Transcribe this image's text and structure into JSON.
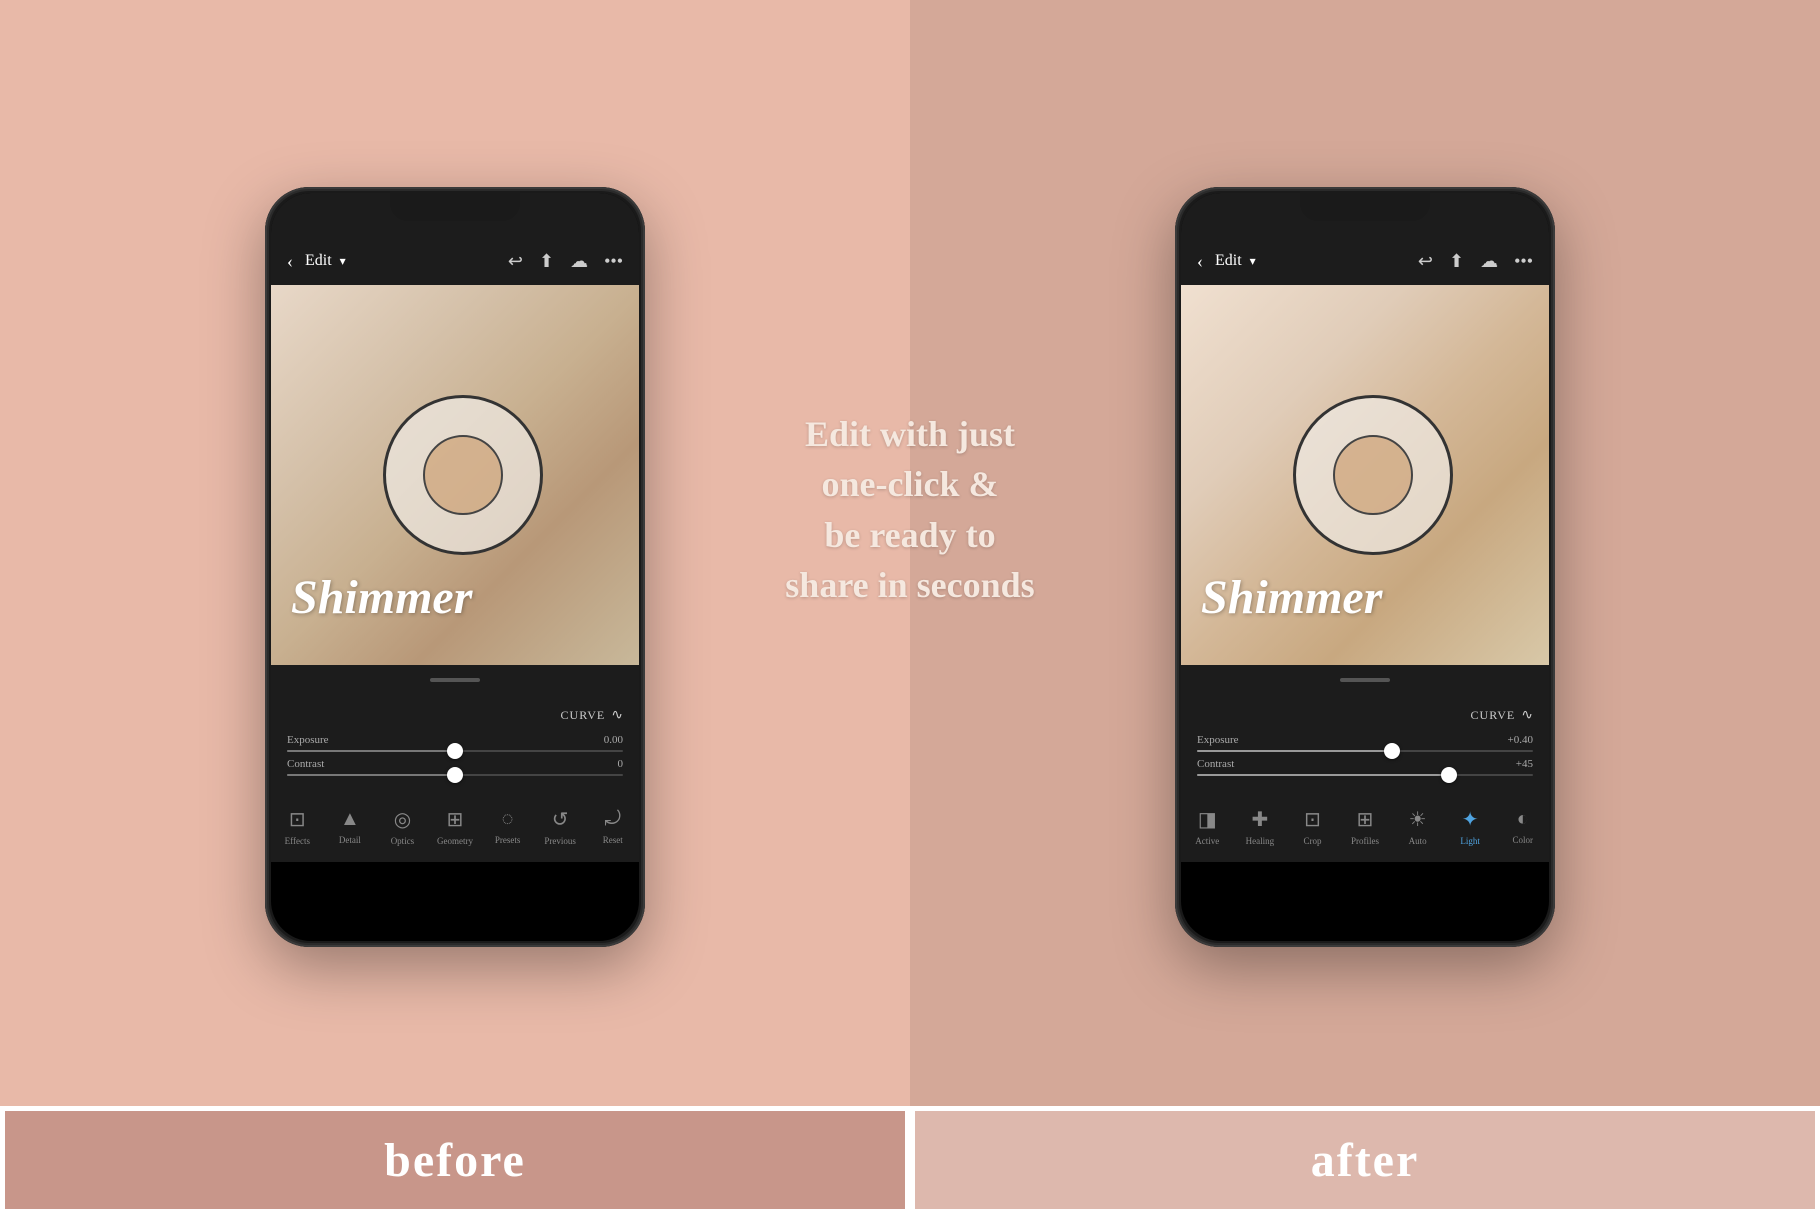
{
  "left": {
    "background_color": "#e8b9a8",
    "phone": {
      "top_bar": {
        "back": "‹",
        "edit_label": "Edit",
        "edit_arrow": "▾"
      },
      "photo": {
        "shimmer_text": "Shimmer"
      },
      "curve_label": "CURVE",
      "exposure_label": "Exposure",
      "exposure_value": "0.00",
      "contrast_label": "Contrast",
      "contrast_value": "0",
      "nav_items": [
        {
          "label": "Effects",
          "icon": "⊡"
        },
        {
          "label": "Detail",
          "icon": "▲"
        },
        {
          "label": "Optics",
          "icon": "◎"
        },
        {
          "label": "Geometry",
          "icon": "⊞"
        },
        {
          "label": "Presets",
          "icon": "◌"
        },
        {
          "label": "Previous",
          "icon": "↺"
        },
        {
          "label": "Reset",
          "icon": "⤾"
        }
      ]
    },
    "before_label": "before"
  },
  "right": {
    "background_color": "#d4a898",
    "phone": {
      "top_bar": {
        "back": "‹",
        "edit_label": "Edit",
        "edit_arrow": "▾"
      },
      "photo": {
        "shimmer_text": "Shimmer"
      },
      "curve_label": "CURVE",
      "exposure_label": "Exposure",
      "exposure_value": "+0.40",
      "contrast_label": "Contrast",
      "contrast_value": "+45",
      "nav_items": [
        {
          "label": "Active",
          "icon": "◨"
        },
        {
          "label": "Healing",
          "icon": "✚"
        },
        {
          "label": "Crop",
          "icon": "⊡"
        },
        {
          "label": "Profiles",
          "icon": "⊞"
        },
        {
          "label": "Auto",
          "icon": "☀"
        },
        {
          "label": "Light",
          "icon": "✦",
          "active": true
        },
        {
          "label": "Color",
          "icon": "◐"
        }
      ]
    },
    "after_label": "after"
  },
  "center": {
    "text_line1": "Edit with just",
    "text_line2": "one-click &",
    "text_line3": "be ready to",
    "text_line4": "share in seconds"
  }
}
